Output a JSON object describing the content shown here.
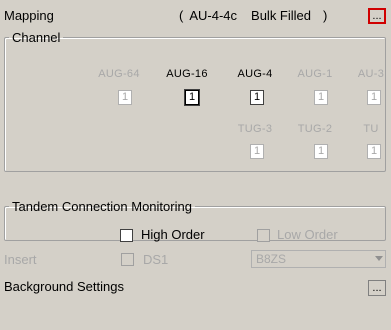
{
  "header": {
    "mapping_label": "Mapping",
    "mapping_open": "(",
    "mapping_value": "AU-4-4c",
    "mapping_mode": "Bulk Filled",
    "mapping_close": ")",
    "dots_label": "..."
  },
  "channel": {
    "legend": "Channel",
    "row1": [
      {
        "label": "AUG-64",
        "value": "1",
        "enabled": false
      },
      {
        "label": "AUG-16",
        "value": "1",
        "enabled": true,
        "selected": true
      },
      {
        "label": "AUG-4",
        "value": "1",
        "enabled": true
      },
      {
        "label": "AUG-1",
        "value": "1",
        "enabled": false
      },
      {
        "label": "AU-3",
        "value": "1",
        "enabled": false
      }
    ],
    "row2": [
      {
        "label": "TUG-3",
        "value": "1",
        "enabled": false
      },
      {
        "label": "TUG-2",
        "value": "1",
        "enabled": false
      },
      {
        "label": "TU",
        "value": "1",
        "enabled": false
      }
    ]
  },
  "tandem": {
    "legend": "Tandem Connection Monitoring",
    "high_order": "High Order",
    "low_order": "Low Order"
  },
  "insert": {
    "label": "Insert",
    "ds1_label": "DS1",
    "coding_value": "B8ZS"
  },
  "background": {
    "label": "Background Settings",
    "dots_label": "..."
  }
}
